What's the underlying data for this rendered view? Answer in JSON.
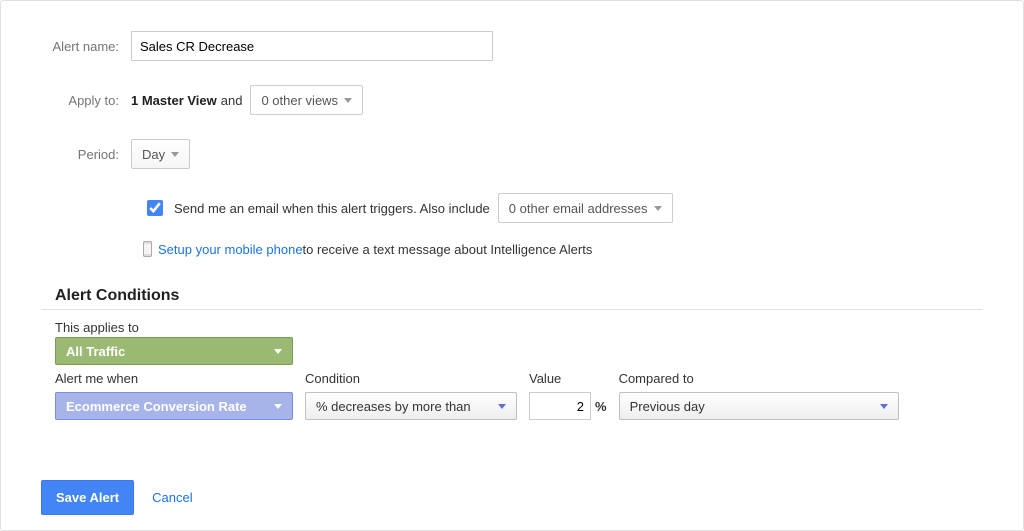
{
  "labels": {
    "alert_name": "Alert name:",
    "apply_to": "Apply to:",
    "period": "Period:"
  },
  "alert_name_value": "Sales CR Decrease",
  "apply_to": {
    "prefix_bold": "1 Master View",
    "connector": " and ",
    "views_dropdown": "0 other views"
  },
  "period_value": "Day",
  "notify": {
    "email_text": "Send me an email when this alert triggers. Also include ",
    "email_dropdown": "0 other email addresses",
    "mobile_link": "Setup your mobile phone",
    "mobile_suffix": " to receive a text message about Intelligence Alerts"
  },
  "conditions": {
    "heading": "Alert Conditions",
    "applies_to_label": "This applies to",
    "applies_to_value": "All Traffic",
    "alert_me_label": "Alert me when",
    "alert_me_value": "Ecommerce Conversion Rate",
    "condition_label": "Condition",
    "condition_value": "% decreases by more than",
    "value_label": "Value",
    "value_value": "2",
    "pct": "%",
    "compared_label": "Compared to",
    "compared_value": "Previous day"
  },
  "buttons": {
    "save": "Save Alert",
    "cancel": "Cancel"
  }
}
